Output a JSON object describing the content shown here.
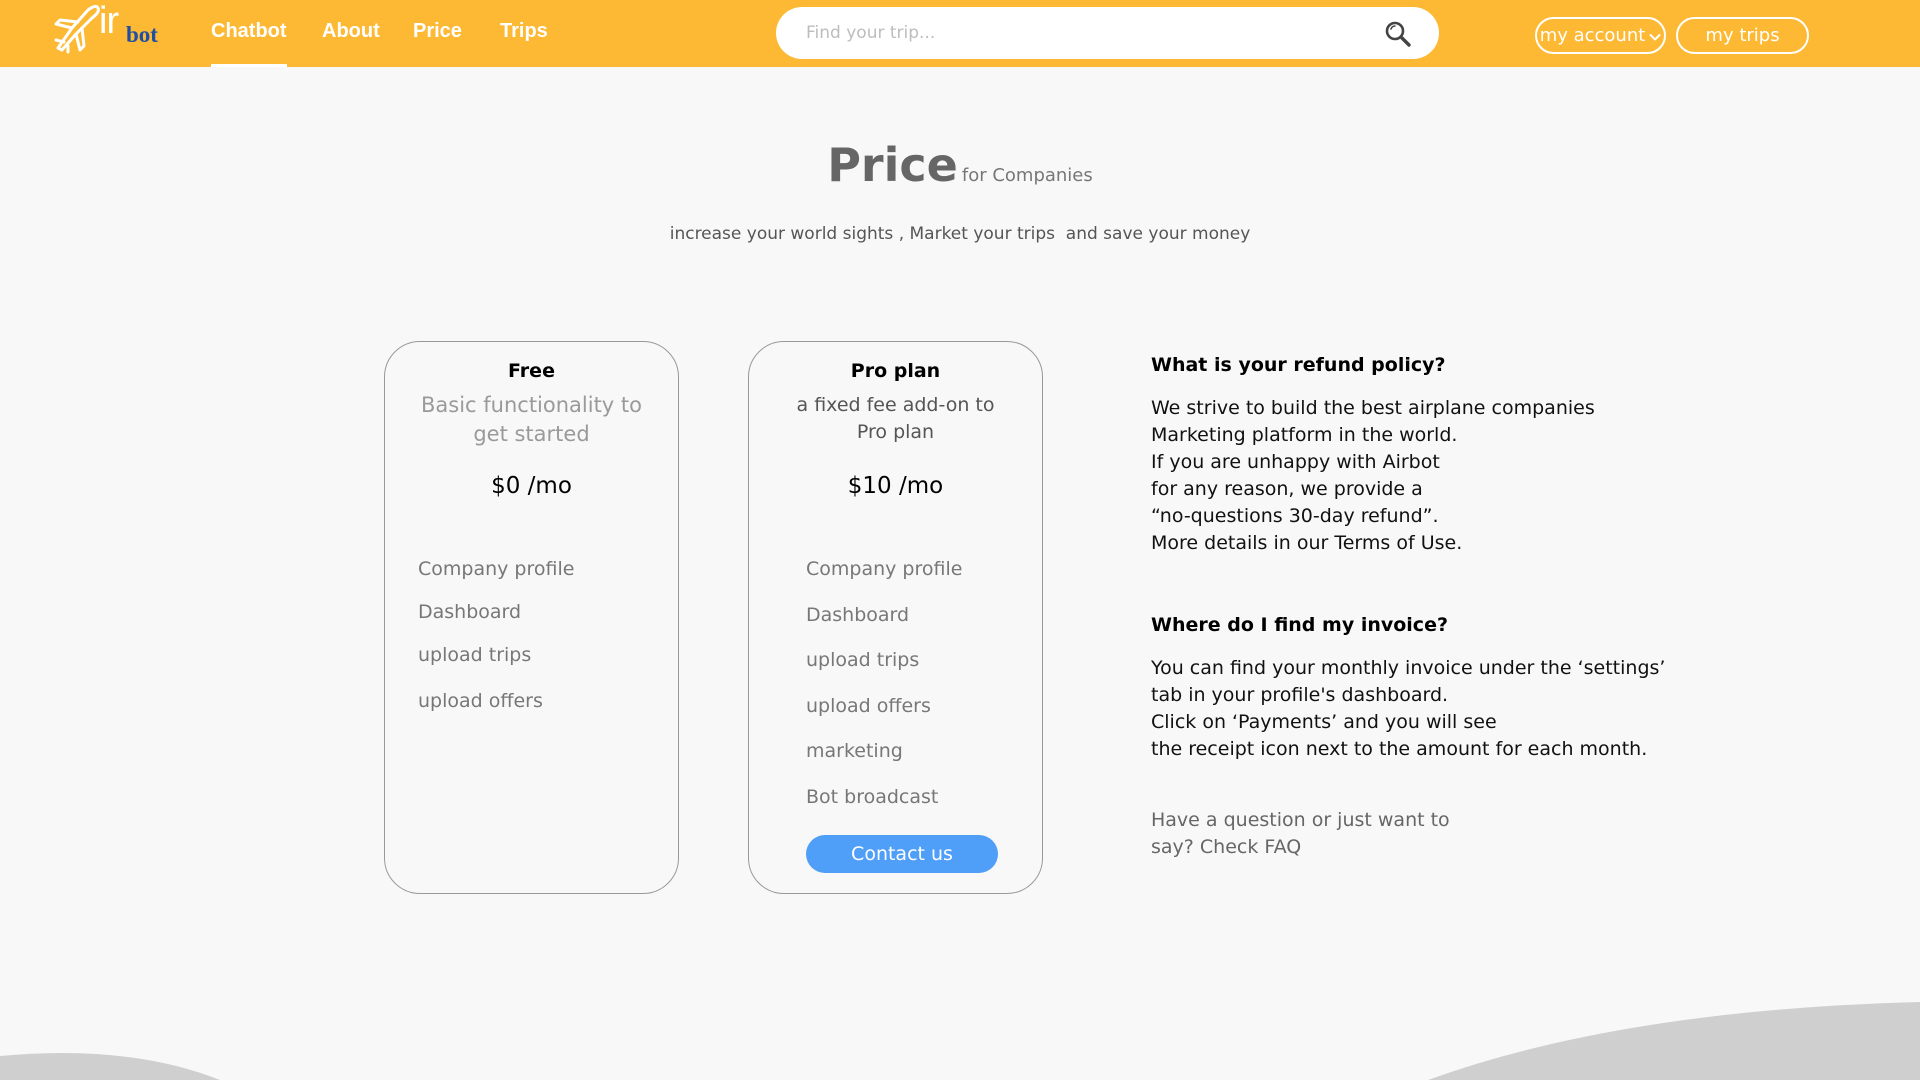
{
  "header": {
    "logo": {
      "ir": "ir",
      "bot": "bot"
    },
    "nav": [
      {
        "label": "Chatbot",
        "active": true
      },
      {
        "label": "About",
        "active": false
      },
      {
        "label": "Price",
        "active": false
      },
      {
        "label": "Trips",
        "active": false
      }
    ],
    "search": {
      "placeholder": "Find your trip..."
    },
    "account_label": "my account",
    "trips_label": "my trips"
  },
  "page": {
    "title": "Price",
    "title_suffix": "for Companies",
    "subtitle": "increase your world sights , Market your trips  and save your money"
  },
  "plans": [
    {
      "name": "Free",
      "description": "Basic functionality to get started",
      "price": "$0 /mo",
      "features": [
        "Company profile",
        "Dashboard",
        "upload trips",
        "upload offers"
      ]
    },
    {
      "name": "Pro plan",
      "description": "a fixed fee add-on to Pro plan",
      "price": "$10 /mo",
      "features": [
        "Company profile",
        "Dashboard",
        "upload trips",
        "upload offers",
        "marketing",
        "Bot broadcast"
      ],
      "button_label": "Contact us"
    }
  ],
  "faq": [
    {
      "question": "What is your refund policy?",
      "answer_lines": [
        "We strive to build the best airplane companies",
        "Marketing platform in the world.",
        "If you are unhappy with Airbot",
        "for any reason, we provide a",
        "“no-questions 30-day refund”.",
        "More details in our Terms of Use."
      ]
    },
    {
      "question": "Where do I find my invoice?",
      "answer_lines": [
        "You can find your monthly invoice under the ‘settings’",
        "tab in your profile's dashboard.",
        "Click on ‘Payments’ and you will see",
        "the receipt icon next to the amount for each month."
      ]
    }
  ],
  "faq_note_lines": [
    "Have a question or just want to",
    "say? Check FAQ"
  ],
  "colors": {
    "header": "#fdb933",
    "button": "#4f9ef8",
    "logo_bot": "#1f4fa3",
    "wave": "#cfcfcf"
  }
}
